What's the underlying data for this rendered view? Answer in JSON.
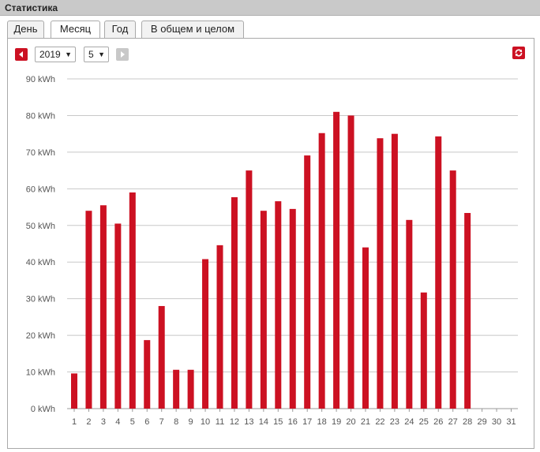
{
  "window": {
    "title": "Статистика"
  },
  "tabs": [
    {
      "label": "День",
      "active": false
    },
    {
      "label": "Месяц",
      "active": true
    },
    {
      "label": "Год",
      "active": false
    },
    {
      "label": "В общем и целом",
      "active": false
    }
  ],
  "controls": {
    "year_value": "2019",
    "month_value": "5",
    "dropdown_glyph": "▼",
    "prev_icon": "triangle-left-icon",
    "next_icon": "triangle-right-icon",
    "refresh_icon": "refresh-icon"
  },
  "colors": {
    "accent": "#cc1122",
    "bar": "#cc1122",
    "disabled": "#c8c8c8",
    "grid": "#c8c8c8"
  },
  "chart_data": {
    "type": "bar",
    "categories": [
      "1",
      "2",
      "3",
      "4",
      "5",
      "6",
      "7",
      "8",
      "9",
      "10",
      "11",
      "12",
      "13",
      "14",
      "15",
      "16",
      "17",
      "18",
      "19",
      "20",
      "21",
      "22",
      "23",
      "24",
      "25",
      "26",
      "27",
      "28",
      "29",
      "30",
      "31"
    ],
    "values": [
      9.6,
      54,
      55.5,
      50.5,
      59,
      18.7,
      28,
      10.6,
      10.6,
      40.8,
      44.6,
      57.7,
      65,
      54,
      56.6,
      54.5,
      69.1,
      75.2,
      81,
      80,
      44,
      73.8,
      75,
      51.5,
      31.7,
      74.3,
      65,
      53.4,
      null,
      null,
      null
    ],
    "unit": "kWh",
    "ylim": [
      0,
      90
    ],
    "yticks": [
      "0 kWh",
      "10 kWh",
      "20 kWh",
      "30 kWh",
      "40 kWh",
      "50 kWh",
      "60 kWh",
      "70 kWh",
      "80 kWh",
      "90 kWh"
    ],
    "grid": true,
    "legend": "none"
  }
}
